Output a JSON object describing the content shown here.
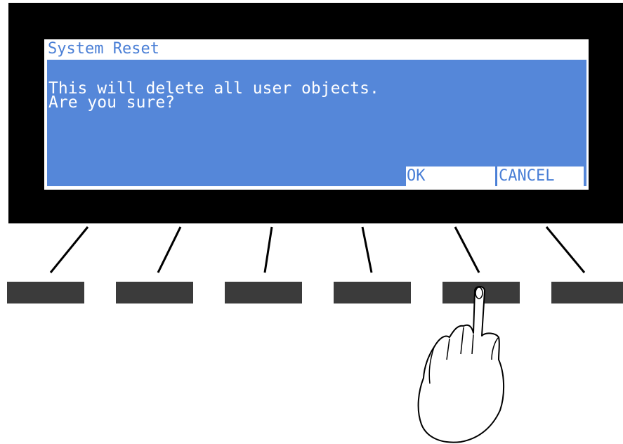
{
  "dialog": {
    "title": "System Reset",
    "message_line_1": "This will delete all user objects.",
    "message_line_2": "Are you sure?"
  },
  "softkey_labels": {
    "ok": "OK",
    "cancel": "CANCEL"
  },
  "colors": {
    "bezel": "#000000",
    "screen_bg": "#ffffff",
    "panel_bg": "#5587d9",
    "title_text": "#4a7fd6",
    "message_text": "#ffffff",
    "softkey_button": "#3b3b3b"
  },
  "icons": {
    "pointer": "pointing-hand-icon"
  }
}
